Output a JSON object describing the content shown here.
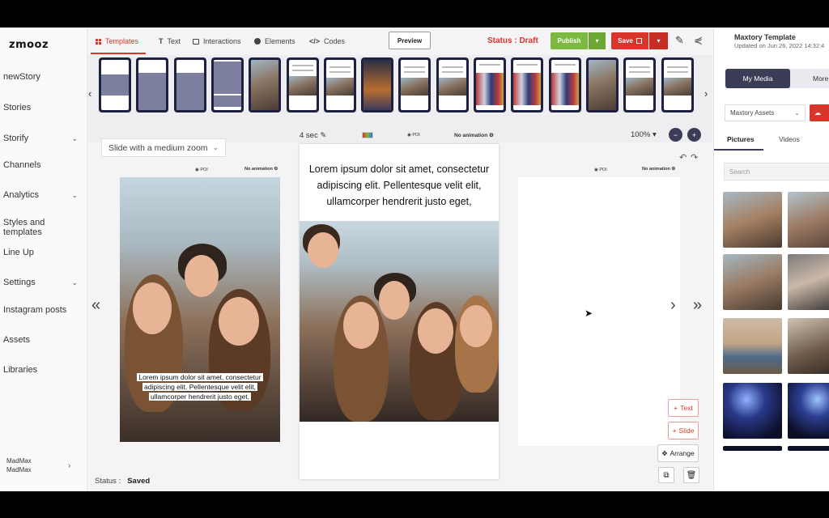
{
  "app": {
    "logo": "zmooz"
  },
  "sidebar": {
    "items": [
      {
        "label": "newStory",
        "has_chevron": false
      },
      {
        "label": "Stories",
        "has_chevron": false
      },
      {
        "label": "Storify",
        "has_chevron": true
      },
      {
        "label": "Channels",
        "has_chevron": false
      },
      {
        "label": "Analytics",
        "has_chevron": true
      },
      {
        "label": "Styles and templates",
        "has_chevron": false
      },
      {
        "label": "Line Up",
        "has_chevron": false
      },
      {
        "label": "Settings",
        "has_chevron": true
      },
      {
        "label": "Instagram posts",
        "has_chevron": false
      },
      {
        "label": "Assets",
        "has_chevron": false
      },
      {
        "label": "Libraries",
        "has_chevron": false
      }
    ],
    "user": {
      "name": "MadMax",
      "sub": "MadMax"
    }
  },
  "toolbar": {
    "tabs": [
      {
        "label": "Templates",
        "icon": "grid-icon"
      },
      {
        "label": "Text",
        "icon": "text-icon"
      },
      {
        "label": "Interactions",
        "icon": "image-icon"
      },
      {
        "label": "Elements",
        "icon": "circle-icon"
      },
      {
        "label": "Codes",
        "icon": "code-icon"
      }
    ],
    "preview_label": "Preview",
    "status_label": "Status : Draft",
    "publish_label": "Publish",
    "save_label": "Save"
  },
  "editor": {
    "animation_select": "Slide with a medium zoom",
    "duration": "4 sec",
    "poi_label": "POI",
    "no_animation_label": "No animation",
    "zoom_level": "100%",
    "main_text": "Lorem ipsum dolor sit amet, consectetur adipiscing elit. Pellentesque velit elit, ullamcorper hendrerit justo eget,",
    "prev_caption": "Lorem ipsum dolor sit amet, consectetur adipiscing elit. Pellentesque velit elit, ullamcorper hendrerit justo eget,",
    "text_button": "Text",
    "slide_button": "Slide",
    "arrange_button": "Arrange",
    "status_label": "Status :",
    "status_value": "Saved"
  },
  "right_panel": {
    "title": "Maxtory Template",
    "updated": "Updated on Jun 26, 2022 14:32:4",
    "my_media": "My Media",
    "more_media": "More med",
    "assets_select": "Maxtory Assets",
    "tabs": [
      "Pictures",
      "Videos"
    ],
    "search_placeholder": "Search"
  },
  "colors": {
    "accent": "#d9362b",
    "publish": "#7db940",
    "dark": "#3a3d55"
  }
}
